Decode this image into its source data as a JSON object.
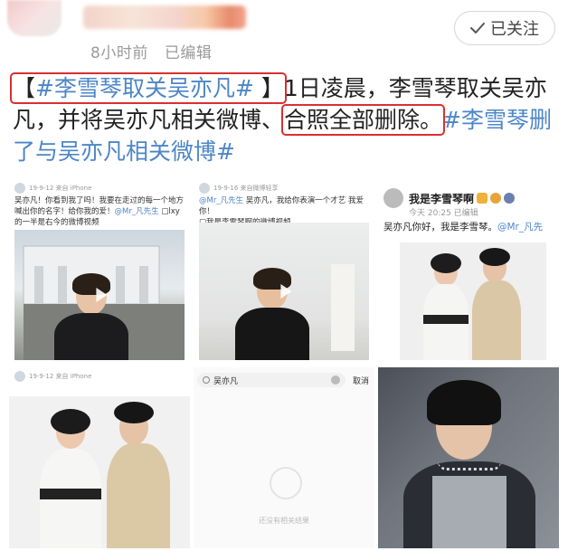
{
  "header": {
    "time": "8小时前",
    "edited": "已编辑",
    "follow_label": "已关注"
  },
  "post": {
    "bracket_open": "【",
    "hashtag_1": "#李雪琴取关吴亦凡#",
    "bracket_close": " 】",
    "text_1": "1日凌晨，李雪琴取关吴亦凡，并将吴亦凡相关微博、",
    "boxed_text": "合照全部删除。",
    "hashtag_2": "#李雪琴删了与吴亦凡相关微博#"
  },
  "images": {
    "img1": {
      "meta": "19-9-12  来自 iPhone",
      "text": "吴亦凡！你看到我了吗！我要在走过的每一个地方喊出你的名字！给你我的爱！",
      "mention": "@Mr_凡先生",
      "tail": "□lxy的一半是右今的微博视频"
    },
    "img2": {
      "meta": "19-9-16  来自微博轻享",
      "mention": "@Mr_凡先生",
      "text": " 吴亦凡，我给你表演一个才艺 我爱你！",
      "tail": "□我是李雪琴啊的微博视频"
    },
    "img3": {
      "name": "我是李雪琴啊",
      "time": "今天 20:25  已编辑",
      "body": "吴亦凡你好，我是李雪琴。",
      "mention": "@Mr_凡先"
    },
    "img5": {
      "query": "吴亦凡",
      "cancel": "取消",
      "empty": "还没有相关结果"
    }
  },
  "colors": {
    "hashtag": "#4d86c7",
    "highlight_box": "#d93030",
    "meta_gray": "#9a9a9a"
  }
}
